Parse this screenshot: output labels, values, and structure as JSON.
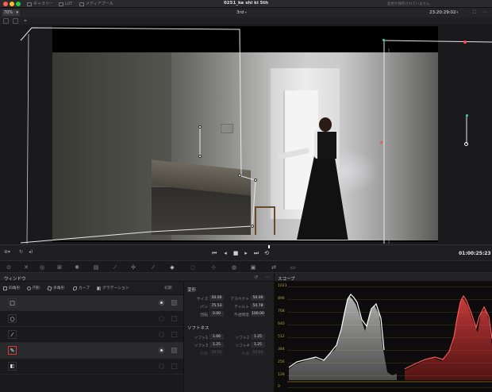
{
  "titlebar": {
    "tabs": [
      {
        "label": "ギャラリー"
      },
      {
        "label": "LUT"
      },
      {
        "label": "メディアプール"
      }
    ],
    "project_title": "0251_ke shi ki 5th",
    "save_status": "変更が保存されていません"
  },
  "viewer_toolbar": {
    "zoom": "70%",
    "clip_name": "3rd",
    "timecode": "23:20:29:02"
  },
  "transport": {
    "timecode": "01:00:25:23"
  },
  "window_panel": {
    "title": "ウィンドウ",
    "shapes": [
      {
        "label": "四角形",
        "icon": "square-icon"
      },
      {
        "label": "円形",
        "icon": "circle-icon"
      },
      {
        "label": "多角形",
        "icon": "polygon-icon"
      },
      {
        "label": "カーブ",
        "icon": "curve-icon"
      },
      {
        "label": "グラデーション",
        "icon": "gradient-icon"
      }
    ],
    "reset_label": "初期",
    "windows": [
      {
        "icon": "square-window-icon",
        "enabled": true
      },
      {
        "icon": "circle-window-icon",
        "enabled": false
      },
      {
        "icon": "line-window-icon",
        "enabled": false
      },
      {
        "icon": "pen-window-icon",
        "enabled": true
      },
      {
        "icon": "gradient-window-icon",
        "enabled": false
      }
    ]
  },
  "transform": {
    "section": "変形",
    "fields": [
      {
        "label": "サイズ",
        "value": "50.00"
      },
      {
        "label": "アスペクト",
        "value": "50.00"
      },
      {
        "label": "パン",
        "value": "75.53"
      },
      {
        "label": "ティルト",
        "value": "54.78"
      },
      {
        "label": "回転",
        "value": "0.00"
      },
      {
        "label": "不透明度",
        "value": "100.00"
      }
    ]
  },
  "softness": {
    "section": "ソフトネス",
    "fields": [
      {
        "label": "ソフト1",
        "value": "1.66"
      },
      {
        "label": "ソフト2",
        "value": "1.25"
      },
      {
        "label": "ソフト3",
        "value": "1.25"
      },
      {
        "label": "ソフト4",
        "value": "1.25"
      },
      {
        "label": "内側",
        "value": "50.00"
      },
      {
        "label": "外側",
        "value": "50.00"
      }
    ]
  },
  "scope": {
    "title": "スコープ",
    "ticks": [
      "1023",
      "896",
      "768",
      "640",
      "512",
      "384",
      "256",
      "128",
      "0"
    ]
  },
  "colors": {
    "accent_red": "#d13a3a",
    "scope_tick": "#c89a2a",
    "window_handle_green": "#3ad19a"
  }
}
